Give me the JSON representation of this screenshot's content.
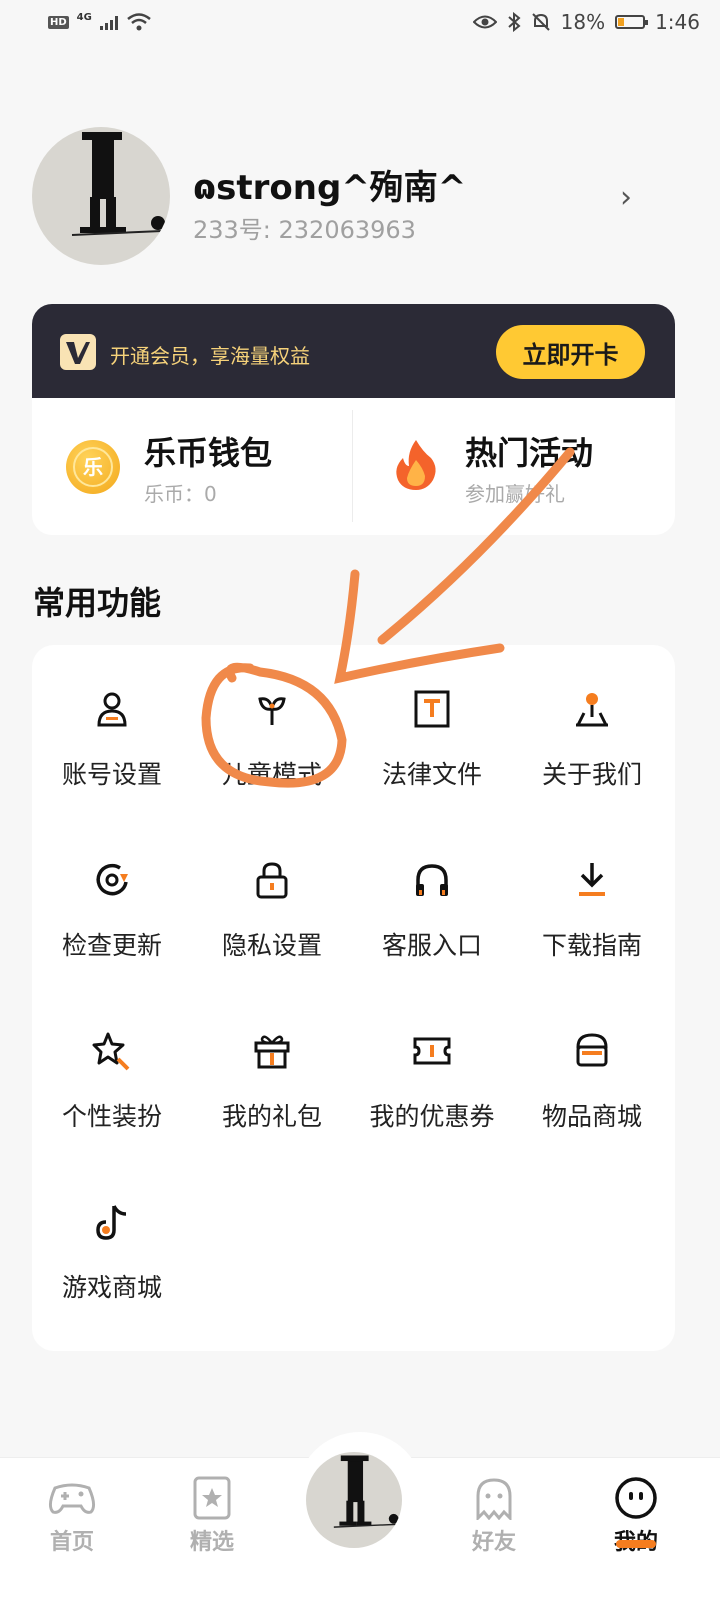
{
  "status_bar": {
    "network": "4G",
    "battery": "18%",
    "time": "1:46"
  },
  "profile": {
    "username": "ɷstrong^殉南^",
    "id_line": "233号: 232063963"
  },
  "vip": {
    "text": "开通会员，享海量权益",
    "button": "立即开卡"
  },
  "wallet": {
    "title": "乐币钱包",
    "sub": "乐币：0",
    "coin_glyph": "乐"
  },
  "events": {
    "title": "热门活动",
    "sub": "参加赢好礼"
  },
  "section_title": "常用功能",
  "functions": [
    {
      "label": "账号设置",
      "icon": "account-icon"
    },
    {
      "label": "儿童模式",
      "icon": "sprout-icon"
    },
    {
      "label": "法律文件",
      "icon": "document-icon"
    },
    {
      "label": "关于我们",
      "icon": "location-pin-icon"
    },
    {
      "label": "检查更新",
      "icon": "refresh-icon"
    },
    {
      "label": "隐私设置",
      "icon": "lock-icon"
    },
    {
      "label": "客服入口",
      "icon": "headphones-icon"
    },
    {
      "label": "下载指南",
      "icon": "download-icon"
    },
    {
      "label": "个性装扮",
      "icon": "star-wand-icon"
    },
    {
      "label": "我的礼包",
      "icon": "gift-icon"
    },
    {
      "label": "我的优惠券",
      "icon": "ticket-icon"
    },
    {
      "label": "物品商城",
      "icon": "store-icon"
    },
    {
      "label": "游戏商城",
      "icon": "music-note-icon"
    }
  ],
  "bottom_nav": [
    {
      "label": "首页",
      "icon": "gamepad-icon",
      "active": false
    },
    {
      "label": "精选",
      "icon": "star-card-icon",
      "active": false
    },
    {
      "label": "好友",
      "icon": "ghost-icon",
      "active": false
    },
    {
      "label": "我的",
      "icon": "face-icon",
      "active": true
    }
  ],
  "colors": {
    "accent": "#f57d1f",
    "vip_bg": "#2b2a36",
    "vip_gold": "#ffc933",
    "annotation": "#f0894a"
  }
}
